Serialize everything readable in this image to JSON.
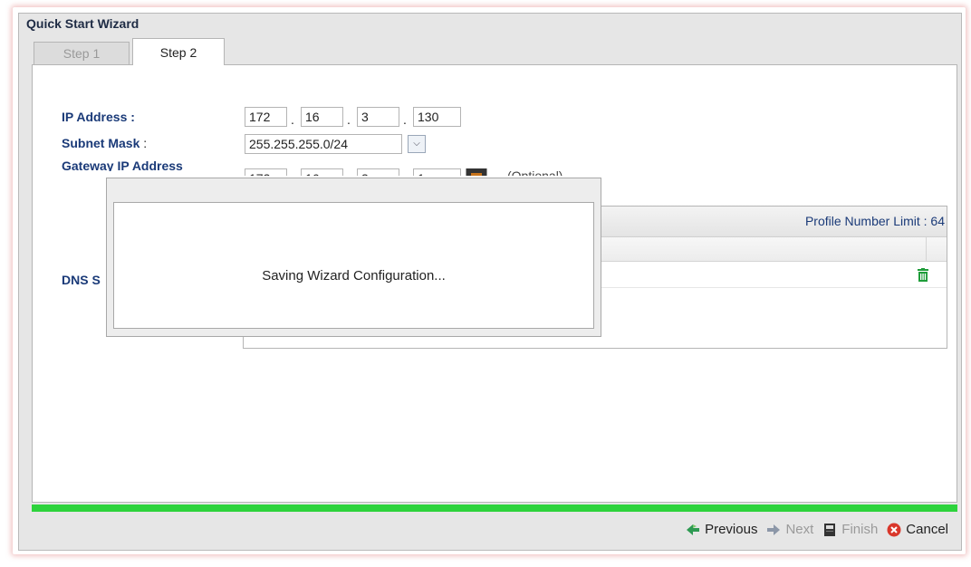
{
  "window": {
    "title": "Quick Start Wizard"
  },
  "tabs": [
    {
      "label": "Step 1",
      "active": false
    },
    {
      "label": "Step 2",
      "active": true
    }
  ],
  "form": {
    "ip_label": "IP Address :",
    "ip": [
      "172",
      "16",
      "3",
      "130"
    ],
    "subnet_label": "Subnet Mask",
    "subnet_suffix": ":",
    "subnet_value": "255.255.255.0/24",
    "gateway_label": "Gateway IP Address",
    "gateway": [
      "172",
      "16",
      "3",
      "1"
    ],
    "gateway_optional": "(Optional)",
    "dns_label": "DNS S"
  },
  "dns_table": {
    "limit_text": "Profile Number Limit : 64"
  },
  "modal": {
    "message": "Saving Wizard Configuration..."
  },
  "footer": {
    "previous": "Previous",
    "next": "Next",
    "finish": "Finish",
    "cancel": "Cancel"
  },
  "colors": {
    "progress": "#2dd33c",
    "label_blue": "#1a3a78",
    "cancel_red": "#d9372b",
    "trash_green": "#1f9d3a"
  },
  "icons": {
    "gateway_picker": "toolbox-icon",
    "row_delete": "trash-icon",
    "previous": "arrow-left-icon",
    "next": "arrow-right-icon",
    "finish": "save-icon",
    "cancel": "cancel-icon"
  }
}
